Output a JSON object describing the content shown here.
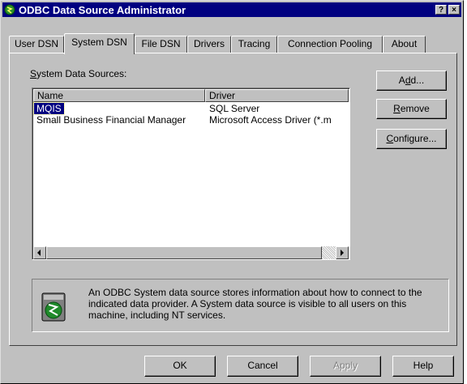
{
  "window": {
    "title": "ODBC Data Source Administrator",
    "help_glyph": "?",
    "close_glyph": "×"
  },
  "tabs": [
    {
      "label": "User DSN",
      "active": false
    },
    {
      "label": "System DSN",
      "active": true
    },
    {
      "label": "File DSN",
      "active": false
    },
    {
      "label": "Drivers",
      "active": false
    },
    {
      "label": "Tracing",
      "active": false
    },
    {
      "label": "Connection Pooling",
      "active": false
    },
    {
      "label": "About",
      "active": false
    }
  ],
  "system_dsn": {
    "section_label_hotkey": "S",
    "section_label_rest": "ystem Data Sources:",
    "columns": [
      "Name",
      "Driver"
    ],
    "rows": [
      {
        "name": "MQIS",
        "driver": "SQL Server",
        "selected": true
      },
      {
        "name": "Small Business Financial Manager",
        "driver": "Microsoft Access Driver (*.m",
        "selected": false
      }
    ],
    "buttons": {
      "add": {
        "pre": "A",
        "hotkey": "d",
        "post": "d..."
      },
      "remove": {
        "pre": "",
        "hotkey": "R",
        "post": "emove"
      },
      "configure": {
        "pre": "",
        "hotkey": "C",
        "post": "onfigure..."
      }
    },
    "info_text": "An ODBC System data source stores information about how to connect to the indicated data provider.  A System data source is visible to all users on this machine, including NT services."
  },
  "footer": {
    "ok": "OK",
    "cancel": "Cancel",
    "apply": "Apply",
    "help": "Help"
  },
  "colors": {
    "titlebar": "#000080",
    "face": "#c0c0c0",
    "selection": "#000080"
  }
}
